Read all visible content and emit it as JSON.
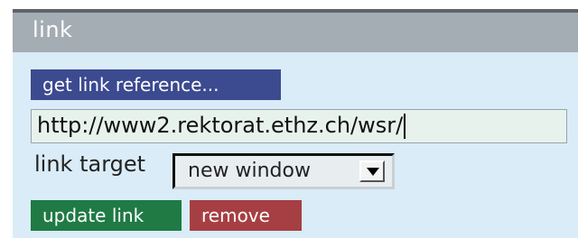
{
  "panel": {
    "title": "link"
  },
  "buttons": {
    "get_reference": "get link reference...",
    "update": "update link",
    "remove": "remove"
  },
  "url_field": {
    "value": "http://www2.rektorat.ethz.ch/wsr/"
  },
  "target": {
    "label": "link target",
    "selected": "new window"
  },
  "colors": {
    "header": "#a4acb4",
    "body": "#d9ecf7",
    "ref_button": "#3c4a90",
    "update_button": "#1f7a44",
    "remove_button": "#a63f43"
  },
  "icons": {
    "select_arrow": "chevron-down-icon"
  }
}
